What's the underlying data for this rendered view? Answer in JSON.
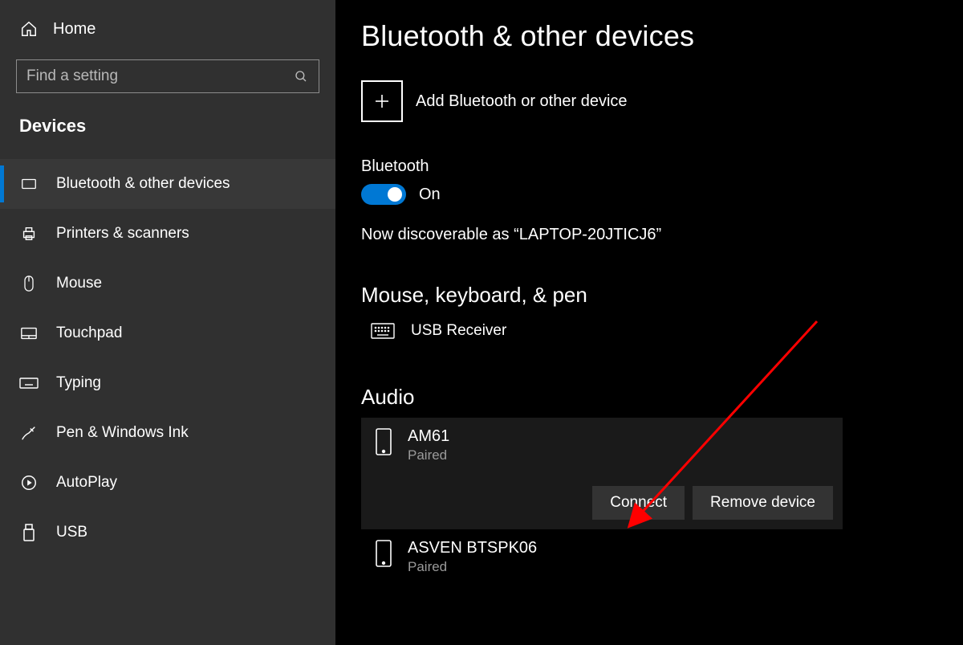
{
  "sidebar": {
    "home_label": "Home",
    "search_placeholder": "Find a setting",
    "section_label": "Devices",
    "items": [
      {
        "label": "Bluetooth & other devices",
        "icon": "bluetooth"
      },
      {
        "label": "Printers & scanners",
        "icon": "printer"
      },
      {
        "label": "Mouse",
        "icon": "mouse"
      },
      {
        "label": "Touchpad",
        "icon": "touchpad"
      },
      {
        "label": "Typing",
        "icon": "keyboard"
      },
      {
        "label": "Pen & Windows Ink",
        "icon": "pen"
      },
      {
        "label": "AutoPlay",
        "icon": "autoplay"
      },
      {
        "label": "USB",
        "icon": "usb"
      }
    ]
  },
  "main": {
    "page_title": "Bluetooth & other devices",
    "add_device_label": "Add Bluetooth or other device",
    "bluetooth_heading": "Bluetooth",
    "bluetooth_toggle_state": "On",
    "discoverable_text": "Now discoverable as “LAPTOP-20JTICJ6”",
    "category_mouse_heading": "Mouse, keyboard, & pen",
    "usb_receiver_label": "USB Receiver",
    "category_audio_heading": "Audio",
    "audio_devices": [
      {
        "name": "AM61",
        "status": "Paired",
        "selected": true
      },
      {
        "name": "ASVEN BTSPK06",
        "status": "Paired",
        "selected": false
      }
    ],
    "connect_label": "Connect",
    "remove_label": "Remove device"
  }
}
